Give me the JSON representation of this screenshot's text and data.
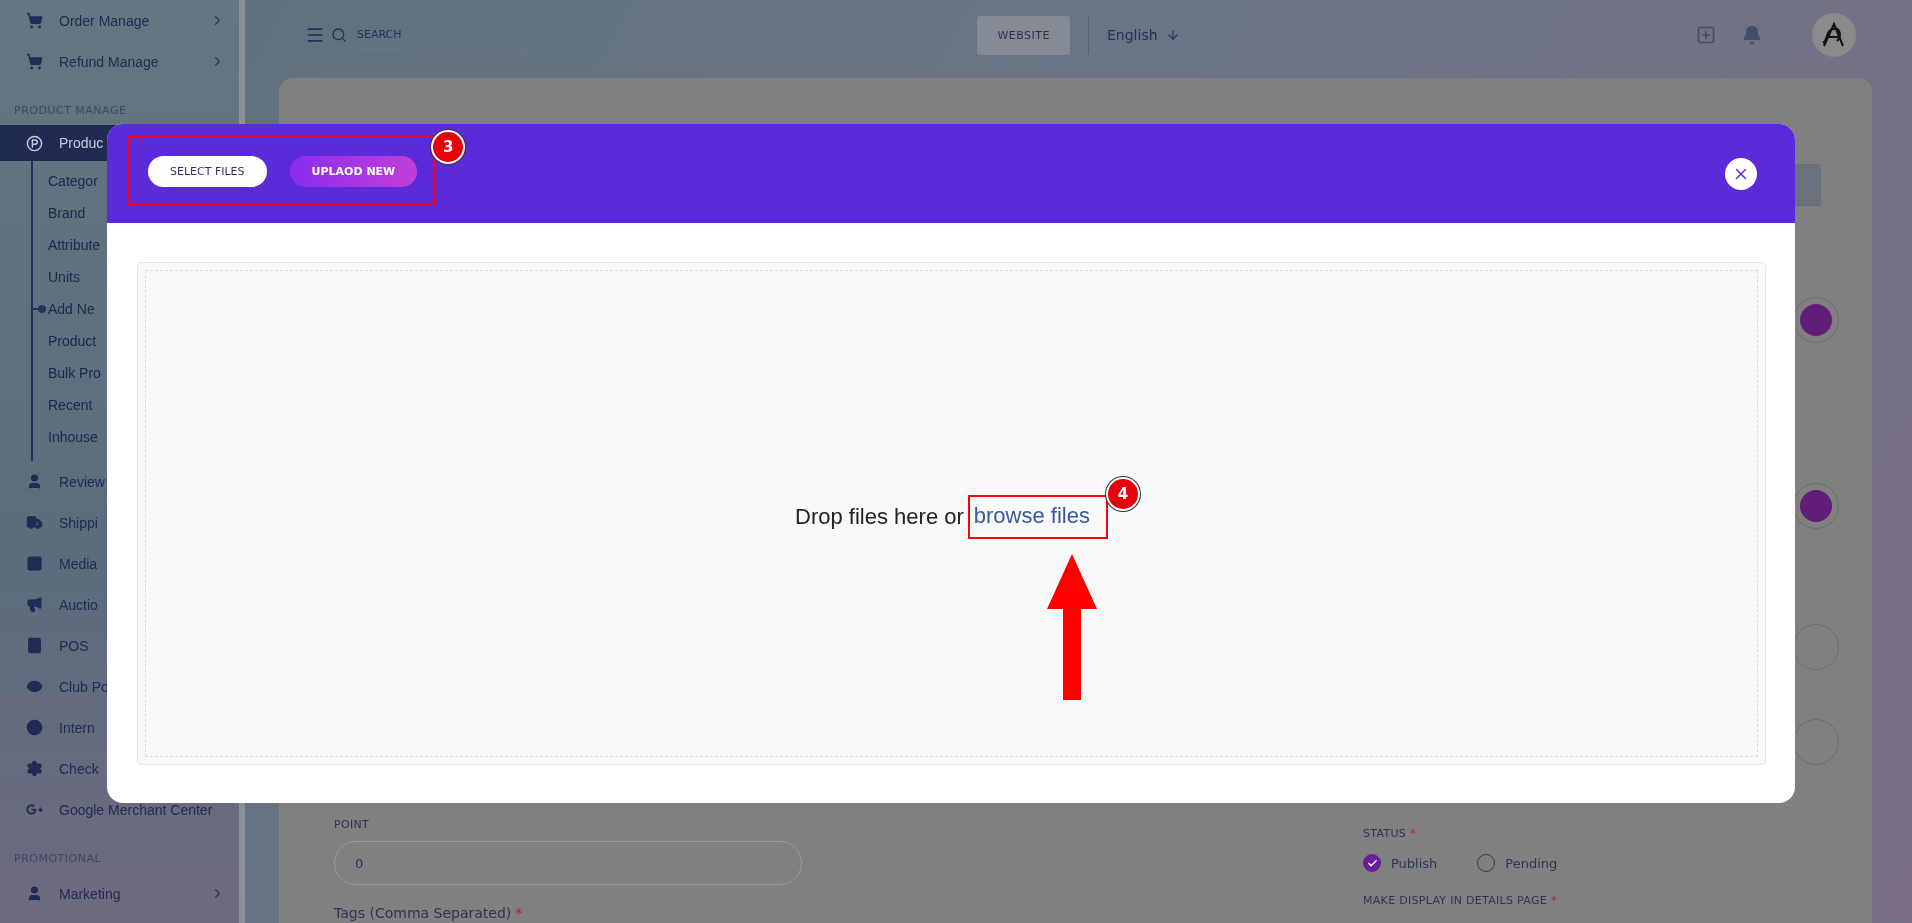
{
  "sidebar": {
    "sections": [
      {
        "items": [
          {
            "label": "Order Manage",
            "kind": "group",
            "selected": false,
            "expanded": false
          },
          {
            "label": "Refund Manage",
            "kind": "group",
            "selected": false,
            "expanded": false
          }
        ]
      },
      {
        "heading": "PRODUCT MANAGE",
        "items": [
          {
            "label": "Produc",
            "kind": "group",
            "selected": true,
            "expanded": true,
            "children": [
              {
                "label": "Categor",
                "selected": false
              },
              {
                "label": "Brand",
                "selected": false
              },
              {
                "label": "Attribute",
                "selected": false
              },
              {
                "label": "Units",
                "selected": false
              },
              {
                "label": "Add Ne",
                "selected": true
              },
              {
                "label": "Product",
                "selected": false
              },
              {
                "label": "Bulk Pro",
                "selected": false
              },
              {
                "label": "Recent",
                "selected": false
              },
              {
                "label": "Inhouse",
                "selected": false
              }
            ]
          },
          {
            "label": "Review",
            "kind": "link",
            "selected": false
          },
          {
            "label": "Shippi",
            "kind": "link",
            "selected": false
          },
          {
            "label": "Media",
            "kind": "link",
            "selected": false
          },
          {
            "label": "Auctio",
            "kind": "link",
            "selected": false
          },
          {
            "label": "POS",
            "kind": "link",
            "selected": false
          },
          {
            "label": "Club Po",
            "kind": "link",
            "selected": false
          },
          {
            "label": "Intern",
            "kind": "link",
            "selected": false
          },
          {
            "label": "Check",
            "kind": "link",
            "selected": false
          },
          {
            "label": "Google Merchant Center",
            "kind": "link",
            "selected": false
          }
        ]
      },
      {
        "heading": "PROMOTIONAL",
        "items": [
          {
            "label": "Marketing",
            "kind": "group",
            "selected": false,
            "expanded": false
          }
        ]
      }
    ]
  },
  "topbar": {
    "search": {
      "placeholder": "SEARCH"
    },
    "website_button": "WEBSITE",
    "language": "English"
  },
  "form": {
    "point": {
      "label": "POINT",
      "value": "0"
    },
    "tags": {
      "label": "Tags (Comma Separated)",
      "required_mark": "*"
    },
    "right_controls": [
      {
        "on": true
      },
      {
        "on": true
      },
      {
        "on": false
      },
      {
        "on": false
      }
    ],
    "status": {
      "label": "STATUS",
      "required_mark": "*",
      "options": [
        {
          "label": "Publish",
          "selected": true
        },
        {
          "label": "Pending",
          "selected": false
        }
      ]
    },
    "display": {
      "label": "MAKE DISPLAY IN DETAILS PAGE",
      "required_mark": "*"
    }
  },
  "modal": {
    "tabs": [
      {
        "label": "SELECT FILES",
        "selected": false
      },
      {
        "label": "UPLAOD NEW",
        "selected": true
      }
    ],
    "dropzone": {
      "text": "Drop files here or",
      "link": "browse files"
    }
  },
  "annotations": [
    {
      "badge": "3"
    },
    {
      "badge": "4"
    }
  ]
}
